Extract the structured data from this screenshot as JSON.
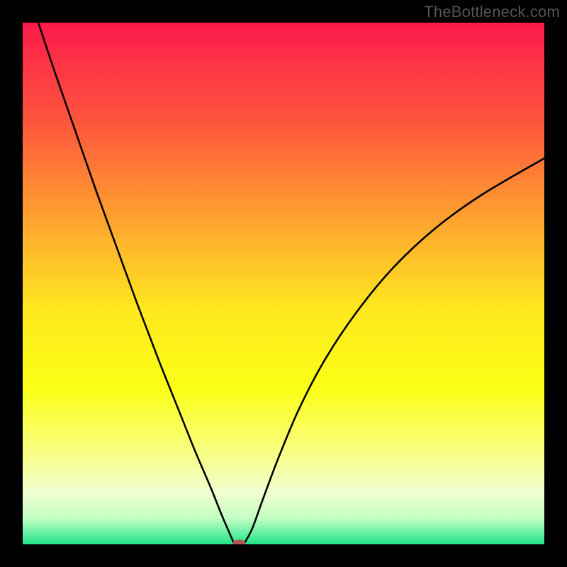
{
  "watermark": "TheBottleneck.com",
  "chart_data": {
    "type": "line",
    "title": "",
    "xlabel": "",
    "ylabel": "",
    "xlim": [
      0,
      100
    ],
    "ylim": [
      0,
      100
    ],
    "background_gradient_stops": [
      {
        "pos": 0.0,
        "color": "#fc1a4b"
      },
      {
        "pos": 0.2,
        "color": "#fd593c"
      },
      {
        "pos": 0.4,
        "color": "#feac2d"
      },
      {
        "pos": 0.55,
        "color": "#fee81f"
      },
      {
        "pos": 0.7,
        "color": "#fbff15"
      },
      {
        "pos": 0.82,
        "color": "#f9ff7f"
      },
      {
        "pos": 0.9,
        "color": "#f0ffd0"
      },
      {
        "pos": 0.95,
        "color": "#c4ffc4"
      },
      {
        "pos": 1.0,
        "color": "#20e38a"
      }
    ],
    "series": [
      {
        "name": "left-branch",
        "x": [
          3.0,
          6.0,
          10.0,
          14.0,
          18.0,
          22.0,
          26.0,
          30.0,
          33.0,
          36.0,
          38.0,
          39.5,
          40.5
        ],
        "y": [
          100.0,
          91.0,
          79.5,
          68.0,
          57.0,
          46.0,
          35.5,
          25.5,
          18.0,
          11.0,
          6.0,
          2.5,
          0.2
        ]
      },
      {
        "name": "right-branch",
        "x": [
          42.5,
          44.0,
          46.0,
          49.0,
          53.0,
          58.0,
          64.0,
          71.0,
          79.0,
          88.0,
          100.0
        ],
        "y": [
          0.2,
          3.0,
          8.5,
          16.5,
          26.0,
          35.5,
          44.5,
          53.0,
          60.5,
          67.0,
          74.0
        ]
      }
    ],
    "marker": {
      "name": "bottleneck-marker",
      "x": 41.5,
      "y": 0.0,
      "rx": 1.3,
      "ry": 0.9,
      "color": "#b85450"
    }
  }
}
